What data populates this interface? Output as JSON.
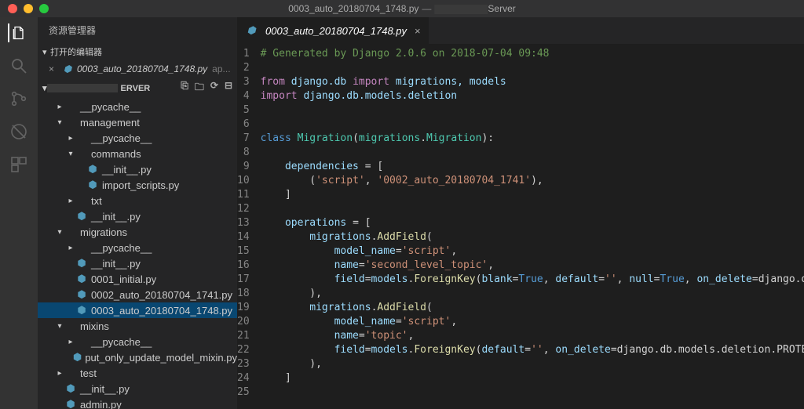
{
  "titlebar": {
    "file": "0003_auto_20180704_1748.py",
    "project_suffix": "Server"
  },
  "activity": {
    "explorer": "Explorer",
    "search": "Search",
    "scm": "Source Control",
    "debug": "Debug",
    "ext": "Extensions"
  },
  "sidebar": {
    "title": "资源管理器",
    "openEditorsLabel": "打开的编辑器",
    "openItem": {
      "name": "0003_auto_20180704_1748.py",
      "hint": "ap..."
    },
    "folderSuffix": "ERVER",
    "tree": [
      {
        "depth": 1,
        "kind": "dir",
        "arrow": "▸",
        "name": "__pycache__"
      },
      {
        "depth": 1,
        "kind": "dir",
        "arrow": "▾",
        "name": "management"
      },
      {
        "depth": 2,
        "kind": "dir",
        "arrow": "▸",
        "name": "__pycache__"
      },
      {
        "depth": 2,
        "kind": "dir",
        "arrow": "▾",
        "name": "commands"
      },
      {
        "depth": 3,
        "kind": "py",
        "arrow": "",
        "name": "__init__.py"
      },
      {
        "depth": 3,
        "kind": "py",
        "arrow": "",
        "name": "import_scripts.py"
      },
      {
        "depth": 2,
        "kind": "dir",
        "arrow": "▸",
        "name": "txt"
      },
      {
        "depth": 2,
        "kind": "py",
        "arrow": "",
        "name": "__init__.py"
      },
      {
        "depth": 1,
        "kind": "dir",
        "arrow": "▾",
        "name": "migrations"
      },
      {
        "depth": 2,
        "kind": "dir",
        "arrow": "▸",
        "name": "__pycache__"
      },
      {
        "depth": 2,
        "kind": "py",
        "arrow": "",
        "name": "__init__.py"
      },
      {
        "depth": 2,
        "kind": "py",
        "arrow": "",
        "name": "0001_initial.py"
      },
      {
        "depth": 2,
        "kind": "py",
        "arrow": "",
        "name": "0002_auto_20180704_1741.py"
      },
      {
        "depth": 2,
        "kind": "py",
        "arrow": "",
        "name": "0003_auto_20180704_1748.py",
        "selected": true
      },
      {
        "depth": 1,
        "kind": "dir",
        "arrow": "▾",
        "name": "mixins"
      },
      {
        "depth": 2,
        "kind": "dir",
        "arrow": "▸",
        "name": "__pycache__"
      },
      {
        "depth": 2,
        "kind": "py",
        "arrow": "",
        "name": "put_only_update_model_mixin.py"
      },
      {
        "depth": 1,
        "kind": "dir",
        "arrow": "▸",
        "name": "test"
      },
      {
        "depth": 1,
        "kind": "py",
        "arrow": "",
        "name": "__init__.py"
      },
      {
        "depth": 1,
        "kind": "py",
        "arrow": "",
        "name": "admin.py"
      }
    ]
  },
  "editor": {
    "tabName": "0003_auto_20180704_1748.py",
    "code": [
      {
        "n": 1,
        "h": "<span class='tk-c'># Generated by Django 2.0.6 on 2018-07-04 09:48</span>"
      },
      {
        "n": 2,
        "h": ""
      },
      {
        "n": 3,
        "h": "<span class='tk-k2'>from</span> <span class='tk-v'>django.db</span> <span class='tk-k2'>import</span> <span class='tk-v'>migrations, models</span>"
      },
      {
        "n": 4,
        "h": "<span class='tk-k2'>import</span> <span class='tk-v'>django.db.models.deletion</span>"
      },
      {
        "n": 5,
        "h": ""
      },
      {
        "n": 6,
        "h": ""
      },
      {
        "n": 7,
        "h": "<span class='tk-k'>class</span> <span class='tk-cls'>Migration</span>(<span class='tk-cls'>migrations</span>.<span class='tk-cls'>Migration</span>):"
      },
      {
        "n": 8,
        "h": ""
      },
      {
        "n": 9,
        "h": "    <span class='tk-v'>dependencies</span> = ["
      },
      {
        "n": 10,
        "h": "        (<span class='tk-s'>'script'</span>, <span class='tk-s'>'0002_auto_20180704_1741'</span>),"
      },
      {
        "n": 11,
        "h": "    ]"
      },
      {
        "n": 12,
        "h": ""
      },
      {
        "n": 13,
        "h": "    <span class='tk-v'>operations</span> = ["
      },
      {
        "n": 14,
        "h": "        <span class='tk-v'>migrations</span>.<span class='tk-fn'>AddField</span>("
      },
      {
        "n": 15,
        "h": "            <span class='tk-v'>model_name</span>=<span class='tk-s'>'script'</span>,"
      },
      {
        "n": 16,
        "h": "            <span class='tk-v'>name</span>=<span class='tk-s'>'second_level_topic'</span>,"
      },
      {
        "n": 17,
        "h": "            <span class='tk-v'>field</span>=<span class='tk-v'>models</span>.<span class='tk-fn'>ForeignKey</span>(<span class='tk-v'>blank</span>=<span class='tk-b'>True</span>, <span class='tk-v'>default</span>=<span class='tk-s'>''</span>, <span class='tk-v'>null</span>=<span class='tk-b'>True</span>, <span class='tk-v'>on_delete</span>=django.db.models.deletion.PROTECT, <span class='tk-v'>related_name</span>=<span class='tk-s'>'script_topic_second_level'</span>, <span class='tk-v'>to</span>=<span class='tk-s'>'script.Topic'</span>),"
      },
      {
        "n": 18,
        "h": "        ),"
      },
      {
        "n": 19,
        "h": "        <span class='tk-v'>migrations</span>.<span class='tk-fn'>AddField</span>("
      },
      {
        "n": 20,
        "h": "            <span class='tk-v'>model_name</span>=<span class='tk-s'>'script'</span>,"
      },
      {
        "n": 21,
        "h": "            <span class='tk-v'>name</span>=<span class='tk-s'>'topic'</span>,"
      },
      {
        "n": 22,
        "h": "            <span class='tk-v'>field</span>=<span class='tk-v'>models</span>.<span class='tk-fn'>ForeignKey</span>(<span class='tk-v'>default</span>=<span class='tk-s'>''</span>, <span class='tk-v'>on_delete</span>=django.db.models.deletion.PROTECT, <span class='tk-v'>related_name</span>=<span class='tk-s'>'script_topic'</span>, <span class='tk-v'>to</span>=<span class='tk-s'>'script.Topic'</span>),"
      },
      {
        "n": 23,
        "h": "        ),"
      },
      {
        "n": 24,
        "h": "    ]"
      },
      {
        "n": 25,
        "h": ""
      }
    ]
  }
}
